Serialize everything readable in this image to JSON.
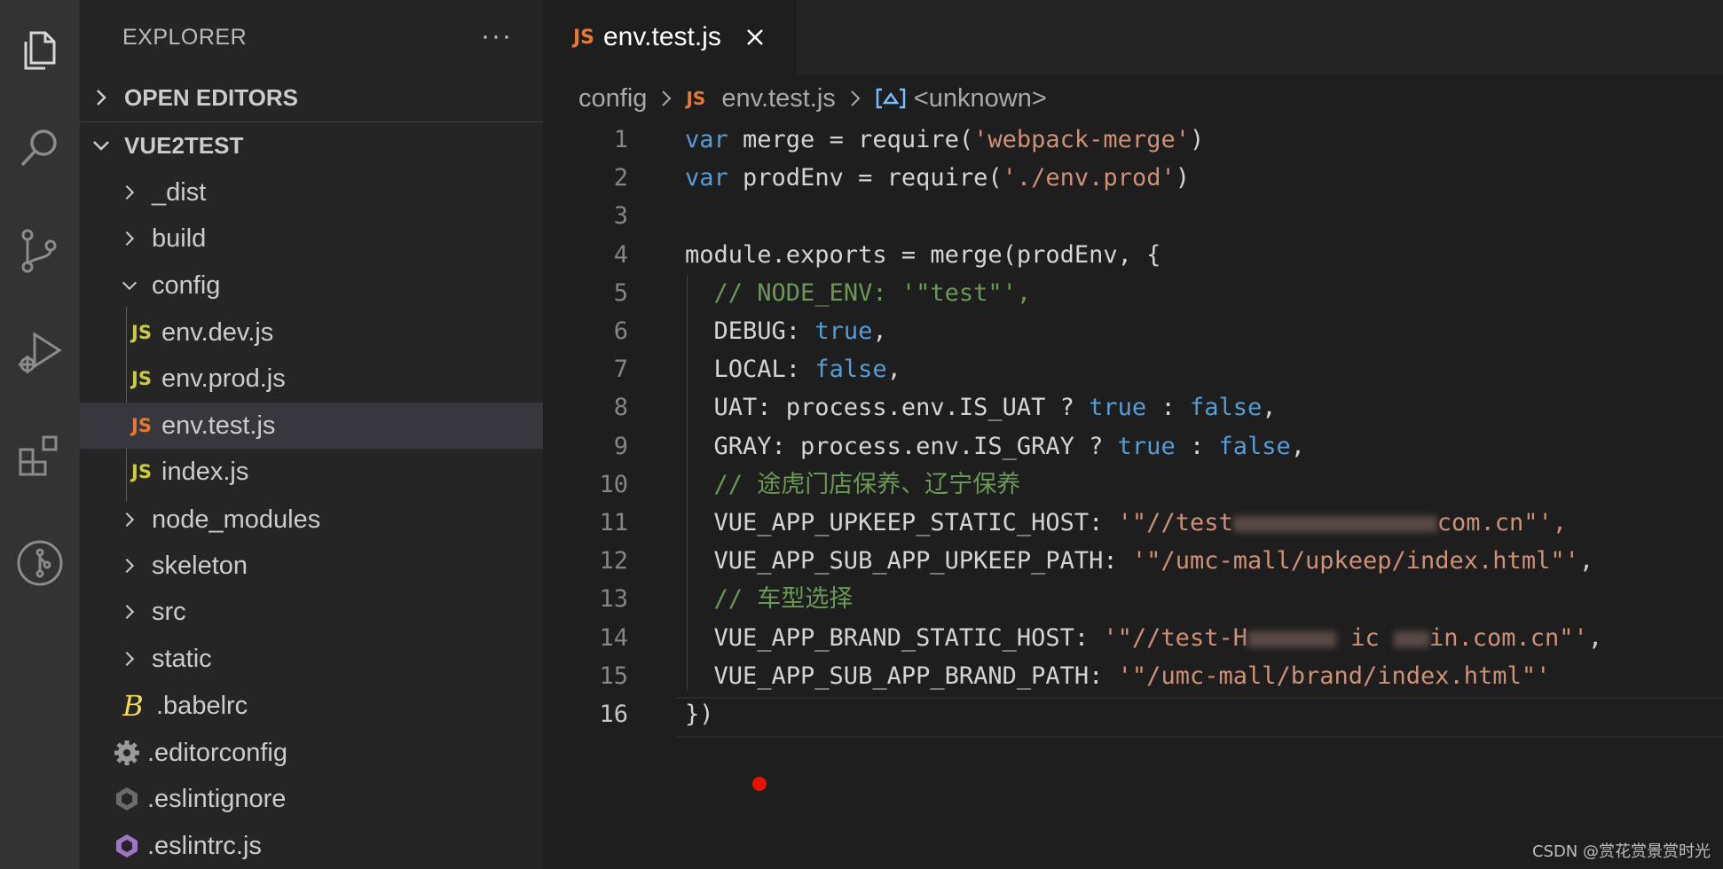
{
  "sidebar": {
    "title": "EXPLORER",
    "more_label": "···",
    "open_editors_label": "OPEN EDITORS",
    "project_label": "VUE2TEST",
    "items": [
      {
        "label": "_dist",
        "kind": "folder"
      },
      {
        "label": "build",
        "kind": "folder"
      },
      {
        "label": "config",
        "kind": "folder-open"
      },
      {
        "label": "env.dev.js",
        "kind": "js"
      },
      {
        "label": "env.prod.js",
        "kind": "js"
      },
      {
        "label": "env.test.js",
        "kind": "js",
        "selected": true
      },
      {
        "label": "index.js",
        "kind": "js"
      },
      {
        "label": "node_modules",
        "kind": "folder"
      },
      {
        "label": "skeleton",
        "kind": "folder"
      },
      {
        "label": "src",
        "kind": "folder"
      },
      {
        "label": "static",
        "kind": "folder"
      },
      {
        "label": ".babelrc",
        "kind": "babel"
      },
      {
        "label": ".editorconfig",
        "kind": "gear"
      },
      {
        "label": ".eslintignore",
        "kind": "eslint"
      },
      {
        "label": ".eslintrc.js",
        "kind": "eslint-js"
      }
    ]
  },
  "tab": {
    "badge": "JS",
    "title": "env.test.js"
  },
  "breadcrumb": {
    "folder": "config",
    "badge": "JS",
    "file": "env.test.js",
    "symbol": "<unknown>"
  },
  "editor": {
    "active_line": 16,
    "lines": [
      {
        "num": "1",
        "parts": [
          {
            "t": "var",
            "c": "kw"
          },
          {
            "t": " merge = require("
          },
          {
            "t": "'webpack-merge'",
            "c": "str"
          },
          {
            "t": ")"
          }
        ]
      },
      {
        "num": "2",
        "parts": [
          {
            "t": "var",
            "c": "kw"
          },
          {
            "t": " prodEnv = require("
          },
          {
            "t": "'./env.prod'",
            "c": "str"
          },
          {
            "t": ")"
          }
        ]
      },
      {
        "num": "3",
        "parts": []
      },
      {
        "num": "4",
        "parts": [
          {
            "t": "module.exports = merge(prodEnv, {"
          }
        ]
      },
      {
        "num": "5",
        "parts": [
          {
            "t": "  "
          },
          {
            "t": "// NODE_ENV: '\"test\"',",
            "c": "cmt"
          }
        ]
      },
      {
        "num": "6",
        "parts": [
          {
            "t": "  DEBUG: "
          },
          {
            "t": "true",
            "c": "kw"
          },
          {
            "t": ","
          }
        ]
      },
      {
        "num": "7",
        "parts": [
          {
            "t": "  LOCAL: "
          },
          {
            "t": "false",
            "c": "kw"
          },
          {
            "t": ","
          }
        ]
      },
      {
        "num": "8",
        "parts": [
          {
            "t": "  UAT: process.env.IS_UAT ? "
          },
          {
            "t": "true",
            "c": "kw"
          },
          {
            "t": " : "
          },
          {
            "t": "false",
            "c": "kw"
          },
          {
            "t": ","
          }
        ]
      },
      {
        "num": "9",
        "parts": [
          {
            "t": "  GRAY: process.env.IS_GRAY ? "
          },
          {
            "t": "true",
            "c": "kw"
          },
          {
            "t": " : "
          },
          {
            "t": "false",
            "c": "kw"
          },
          {
            "t": ","
          }
        ]
      },
      {
        "num": "10",
        "parts": [
          {
            "t": "  "
          },
          {
            "t": "// 途虎门店保养、辽宁保养",
            "c": "cmt"
          }
        ]
      },
      {
        "num": "11",
        "parts": [
          {
            "t": "  VUE_APP_UPKEEP_STATIC_HOST: "
          },
          {
            "t": "'\"//test",
            "c": "str"
          },
          {
            "t": "BLUR:230"
          },
          {
            "t": "com.cn\"',",
            "c": "str"
          }
        ]
      },
      {
        "num": "12",
        "parts": [
          {
            "t": "  VUE_APP_SUB_APP_UPKEEP_PATH: "
          },
          {
            "t": "'\"/umc-mall/upkeep/index.html\"'",
            "c": "str"
          },
          {
            "t": ","
          }
        ]
      },
      {
        "num": "13",
        "parts": [
          {
            "t": "  "
          },
          {
            "t": "// 车型选择",
            "c": "cmt"
          }
        ]
      },
      {
        "num": "14",
        "parts": [
          {
            "t": "  VUE_APP_BRAND_STATIC_HOST: "
          },
          {
            "t": "'\"//test-H",
            "c": "str"
          },
          {
            "t": "BLUR:100"
          },
          {
            "t": " ic ",
            "c": "str"
          },
          {
            "t": "BLUR:40"
          },
          {
            "t": "in.com.cn\"'",
            "c": "str"
          },
          {
            "t": ","
          }
        ]
      },
      {
        "num": "15",
        "parts": [
          {
            "t": "  VUE_APP_SUB_APP_BRAND_PATH: "
          },
          {
            "t": "'\"/umc-mall/brand/index.html\"'",
            "c": "str"
          }
        ]
      },
      {
        "num": "16",
        "parts": [
          {
            "t": "})"
          }
        ]
      }
    ]
  },
  "watermark": "CSDN @赏花赏景赏时光",
  "colors": {
    "activity_bar": "#333333",
    "sidebar": "#252526",
    "editor": "#1e1e1e",
    "keyword": "#569cd6",
    "string": "#ce9178",
    "comment": "#6a9955",
    "js_badge": "#cbcb41",
    "js_badge_active": "#e37933",
    "breakpoint": "#e51400"
  }
}
